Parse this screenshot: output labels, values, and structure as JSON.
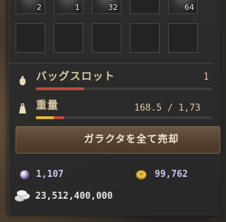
{
  "inventory": {
    "top_counts": [
      "2",
      "1",
      "32",
      "64"
    ]
  },
  "stats": {
    "bag_slot": {
      "label": "バッグスロット",
      "value": "1",
      "fill": 0.27,
      "color": "#c24a3a"
    },
    "weight": {
      "label": "重量",
      "value": "168.5 / 1,73",
      "fill": 0.16,
      "color_a": "#e2b83a",
      "color_b": "#c24a3a"
    }
  },
  "actions": {
    "sell_junk_label": "ガラクタを全て売却"
  },
  "currency": {
    "pearl": "1,107",
    "gold": "99,762",
    "silver": "23,512,400,000"
  },
  "icons": [
    "bag-icon",
    "weight-icon",
    "pearl-icon",
    "gold-coin-icon",
    "silver-coins-icon"
  ]
}
